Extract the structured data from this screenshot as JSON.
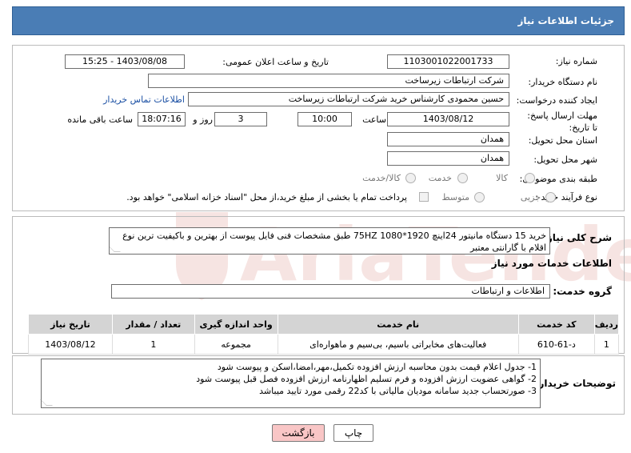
{
  "header": {
    "title": "جزئیات اطلاعات نیاز"
  },
  "form": {
    "need_number_label": "شماره نیاز:",
    "need_number": "1103001022001733",
    "announce_label": "تاریخ و ساعت اعلان عمومی:",
    "announce_value": "1403/08/08 - 15:25",
    "buyer_org_label": "نام دستگاه خریدار:",
    "buyer_org": "شرکت ارتباطات زیرساخت",
    "creator_label": "ایجاد کننده درخواست:",
    "creator": "حسین محمودی کارشناس خرید شرکت ارتباطات زیرساخت",
    "contact_link": "اطلاعات تماس خریدار",
    "deadline_label": "مهلت ارسال پاسخ: تا تاریخ:",
    "deadline_date": "1403/08/12",
    "time_label": "ساعت",
    "deadline_time": "10:00",
    "days_label": "روز و",
    "days_value": "3",
    "remaining_value": "18:07:16",
    "remaining_label": "ساعت باقی مانده",
    "province_label": "استان محل تحویل:",
    "province": "همدان",
    "city_label": "شهر محل تحویل:",
    "city": "همدان",
    "category_label": "طبقه بندی موضوعی:",
    "category_options": [
      "کالا",
      "خدمت",
      "کالا/خدمت"
    ],
    "process_label": "نوع فرآیند خرید :",
    "process_options": [
      "جزیی",
      "متوسط"
    ],
    "payment_note": "پرداخت تمام یا بخشی از مبلغ خرید،از محل \"اسناد خزانه اسلامی\" خواهد بود."
  },
  "summary": {
    "label": "شرح کلی نیاز:",
    "text": "خرید 15 دستگاه مانیتور 24اینچ 1920*1080 75HZ طبق مشخصات فنی فایل پیوست از بهترین و باکیفیت ترین نوع اقلام با گارانتی معتبر"
  },
  "services": {
    "section_title": "اطلاعات خدمات مورد نیاز",
    "group_label": "گروه خدمت:",
    "group_value": "اطلاعات و ارتباطات",
    "columns": [
      "ردیف",
      "کد خدمت",
      "نام خدمت",
      "واحد اندازه گیری",
      "تعداد / مقدار",
      "تاریخ نیاز"
    ],
    "rows": [
      [
        "1",
        "د-61-610",
        "فعالیت‌های مخابراتی باسیم، بی‌سیم و ماهواره‌ای",
        "مجموعه",
        "1",
        "1403/08/12"
      ]
    ]
  },
  "buyer_notes": {
    "label": "توضیحات خریدار:",
    "lines": [
      "1- جدول اعلام قیمت بدون محاسبه ارزش افزوده تکمیل،مهر،امضا،اسکن و پیوست شود",
      "2- گواهی عضویت ارزش افزوده و فرم تسلیم اظهارنامه ارزش افزوده فصل قبل پیوست شود",
      "3- صورتحساب جدید سامانه مودیان مالیاتی با کد22 رقمی مورد تایید میباشد"
    ]
  },
  "buttons": {
    "print": "چاپ",
    "back": "بازگشت"
  },
  "watermark": {
    "text": "AriaTender.net"
  },
  "colors": {
    "header_bg": "#4a7db5",
    "back_button": "#f9c6c6",
    "print_button": "#ffffff",
    "table_header": "#d4d4d4"
  }
}
